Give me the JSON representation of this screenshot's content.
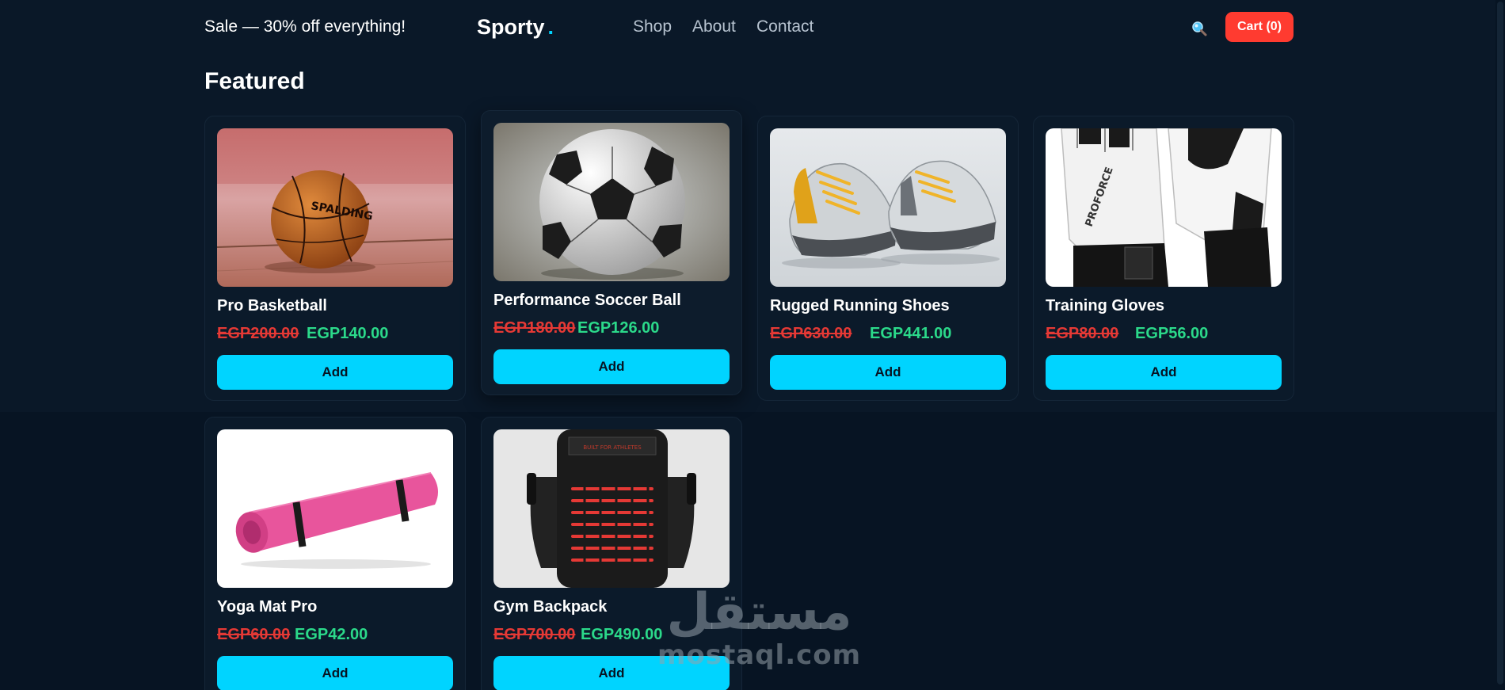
{
  "header": {
    "sale_text": "Sale — 30% off everything!",
    "logo_text": "Sporty",
    "logo_dot": ".",
    "nav": [
      "Shop",
      "About",
      "Contact"
    ],
    "cart_label": "Cart (0)"
  },
  "section": {
    "title": "Featured"
  },
  "products": [
    {
      "name": "Pro Basketball",
      "old_price": "EGP200.00",
      "new_price": "EGP140.00",
      "add_label": "Add"
    },
    {
      "name": "Performance Soccer Ball",
      "old_price": "EGP180.00",
      "new_price": "EGP126.00",
      "add_label": "Add"
    },
    {
      "name": "Rugged Running Shoes",
      "old_price": "EGP630.00",
      "new_price": "EGP441.00",
      "add_label": "Add"
    },
    {
      "name": "Training Gloves",
      "old_price": "EGP80.00",
      "new_price": "EGP56.00",
      "add_label": "Add"
    },
    {
      "name": "Yoga Mat Pro",
      "old_price": "EGP60.00",
      "new_price": "EGP42.00",
      "add_label": "Add"
    },
    {
      "name": "Gym Backpack",
      "old_price": "EGP700.00",
      "new_price": "EGP490.00",
      "add_label": "Add"
    }
  ],
  "watermark": {
    "arabic": "مستقل",
    "latin": "mostaql.com"
  },
  "colors": {
    "background": "#071423",
    "accent": "#00d4ff",
    "cart": "#ff3b30",
    "old_price": "#e53935",
    "new_price": "#2bd98a"
  }
}
